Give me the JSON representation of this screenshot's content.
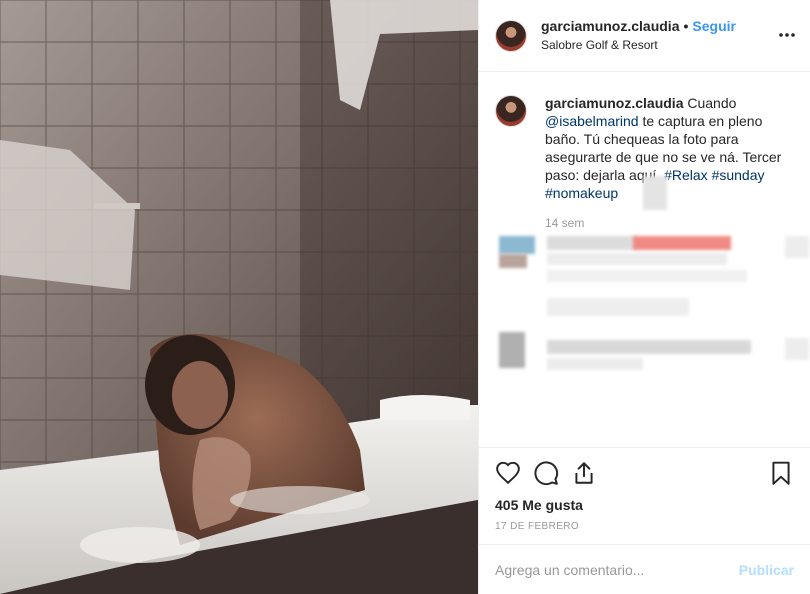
{
  "post": {
    "username": "garciamunoz.claudia",
    "follow_label": "Seguir",
    "separator": "•",
    "location": "Salobre Golf & Resort",
    "more_icon": "more-horizontal-icon"
  },
  "caption": {
    "username": "garciamunoz.claudia",
    "text_1": " Cuando ",
    "mention": "@isabelmarind",
    "text_2": " te captura en pleno baño. Tú chequeas la foto para asegurarte de que no se ve ná. Tercer paso: dejarla aquí. ",
    "tags": [
      "#Relax",
      "#sunday",
      "#nomakeup"
    ],
    "time": "14 sem"
  },
  "actions": {
    "icons": [
      "heart-icon",
      "comment-icon",
      "share-icon",
      "bookmark-icon"
    ],
    "likes": "405 Me gusta",
    "date": "17 DE FEBRERO"
  },
  "comment_box": {
    "placeholder": "Agrega un comentario...",
    "publish_label": "Publicar"
  },
  "colors": {
    "link": "#003569",
    "follow": "#3897f0",
    "publish_disabled": "#b2dffc",
    "highlight_blur": "#f08a84"
  }
}
